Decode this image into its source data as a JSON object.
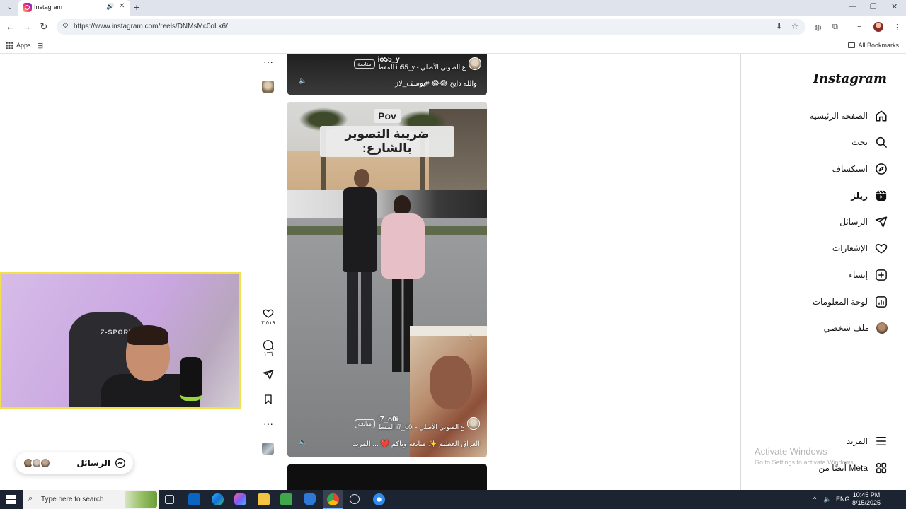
{
  "browser": {
    "tab_title": "Instagram",
    "url": "https://www.instagram.com/reels/DNMsMc0oLk6/",
    "bookmarks": {
      "apps": "Apps",
      "all_bookmarks": "All Bookmarks"
    }
  },
  "instagram": {
    "logo": "Instagram",
    "nav": {
      "home": "الصفحة الرئيسية",
      "search": "بحث",
      "explore": "استكشاف",
      "reels": "ريلز",
      "messages": "الرسائل",
      "notifications": "الإشعارات",
      "create": "إنشاء",
      "dashboard": "لوحة المعلومات",
      "profile": "ملف شخصي",
      "more": "المزيد",
      "also_from_meta": "أيضًا من Meta"
    }
  },
  "reels": {
    "reel1": {
      "username": "io55_y",
      "follow": "متابعة",
      "audio": "ع الصوتي الأصلي - io55_y المقط",
      "caption": "والله دايخ 😂😂 #يوسف_لاز"
    },
    "reel2": {
      "pov": "Pov",
      "title": "ضريبة التصوير بالشارع:",
      "username": "i7_o0i",
      "follow": "متابعة",
      "audio": "ع الصوتي الأصلي - i7_o0i المقط",
      "caption": "العراق العظيم ✨ متابعة وياكم ❤️ ... المزيد",
      "likes": "٣,٥١٩",
      "comments": "١٣٦"
    }
  },
  "webcam": {
    "chair_brand": "Z-SPORT"
  },
  "messages_pill": {
    "label": "الرسائل"
  },
  "watermark": {
    "title": "Activate Windows",
    "subtitle": "Go to Settings to activate Windows."
  },
  "taskbar": {
    "search_placeholder": "Type here to search",
    "lang": "ENG",
    "time": "10:45 PM",
    "date": "8/15/2025"
  }
}
